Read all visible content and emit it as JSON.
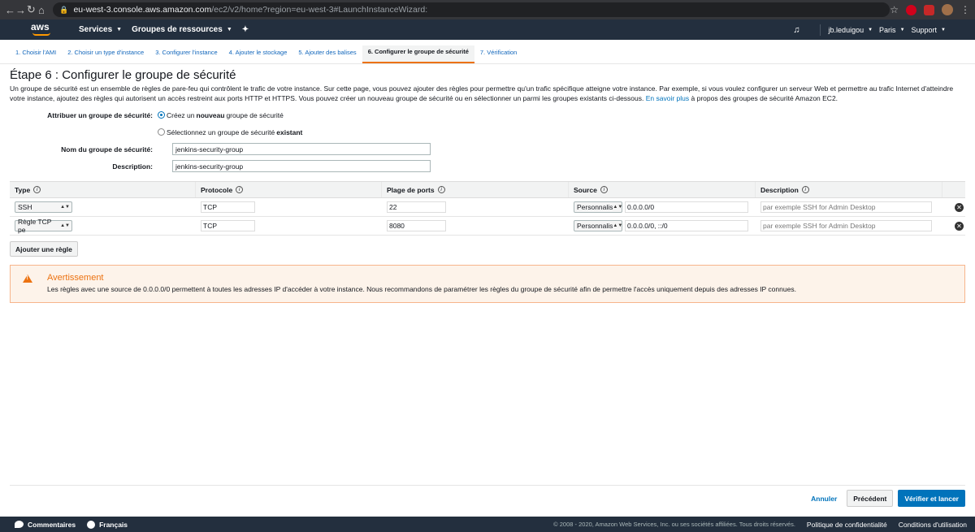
{
  "browser": {
    "url_host": "eu-west-3.console.aws.amazon.com",
    "url_path": "/ec2/v2/home?region=eu-west-3#LaunchInstanceWizard:"
  },
  "awsnav": {
    "logo": "aws",
    "services": "Services",
    "resource_groups": "Groupes de ressources",
    "user": "jb.leduigou",
    "region": "Paris",
    "support": "Support"
  },
  "wizard_tabs": [
    "1. Choisir l'AMI",
    "2. Choisir un type d'instance",
    "3. Configurer l'instance",
    "4. Ajouter le stockage",
    "5. Ajouter des balises",
    "6. Configurer le groupe de sécurité",
    "7. Vérification"
  ],
  "page": {
    "title": "Étape 6 : Configurer le groupe de sécurité",
    "intro": "Un groupe de sécurité est un ensemble de règles de pare-feu qui contrôlent le trafic de votre instance. Sur cette page, vous pouvez ajouter des règles pour permettre qu'un trafic spécifique atteigne votre instance. Par exemple, si vous voulez configurer un serveur Web et permettre au trafic Internet d'atteindre votre instance, ajoutez des règles qui autorisent un accès restreint aux ports HTTP et HTTPS. Vous pouvez créer un nouveau groupe de sécurité ou en sélectionner un parmi les groupes existants ci-dessous.",
    "learn_more": "En savoir plus",
    "intro_tail": "à propos des groupes de sécurité Amazon EC2."
  },
  "form": {
    "assign_label": "Attribuer un groupe de sécurité:",
    "radio_new_prefix": "Créez un ",
    "radio_new_bold": "nouveau",
    "radio_new_suffix": " groupe de sécurité",
    "radio_existing_prefix": "Sélectionnez un groupe de sécurité ",
    "radio_existing_bold": "existant",
    "name_label": "Nom du groupe de sécurité:",
    "name_value": "jenkins-security-group",
    "desc_label": "Description:",
    "desc_value": "jenkins-security-group"
  },
  "rules": {
    "headers": [
      "Type",
      "Protocole",
      "Plage de ports",
      "Source",
      "Description"
    ],
    "rows": [
      {
        "type": "SSH",
        "protocol": "TCP",
        "ports": "22",
        "source_type": "Personnalis",
        "source": "0.0.0.0/0",
        "description_placeholder": "par exemple SSH for Admin Desktop"
      },
      {
        "type": "Règle TCP pe",
        "protocol": "TCP",
        "ports": "8080",
        "source_type": "Personnalis",
        "source": "0.0.0.0/0, ::/0",
        "description_placeholder": "par exemple SSH for Admin Desktop"
      }
    ],
    "add_rule": "Ajouter une règle"
  },
  "warning": {
    "title": "Avertissement",
    "message": "Les règles avec une source de 0.0.0.0/0 permettent à toutes les adresses IP d'accéder à votre instance. Nous recommandons de paramétrer les règles du groupe de sécurité afin de permettre l'accès uniquement depuis des adresses IP connues."
  },
  "actions": {
    "cancel": "Annuler",
    "previous": "Précédent",
    "review_launch": "Vérifier et lancer"
  },
  "footer": {
    "feedback": "Commentaires",
    "language": "Français",
    "copyright": "© 2008 - 2020, Amazon Web Services, Inc. ou ses sociétés affiliées. Tous droits réservés.",
    "privacy": "Politique de confidentialité",
    "terms": "Conditions d'utilisation"
  },
  "colors": {
    "nav_bg": "#232f3e",
    "accent_orange": "#ec7211",
    "primary_blue": "#0073bb"
  }
}
